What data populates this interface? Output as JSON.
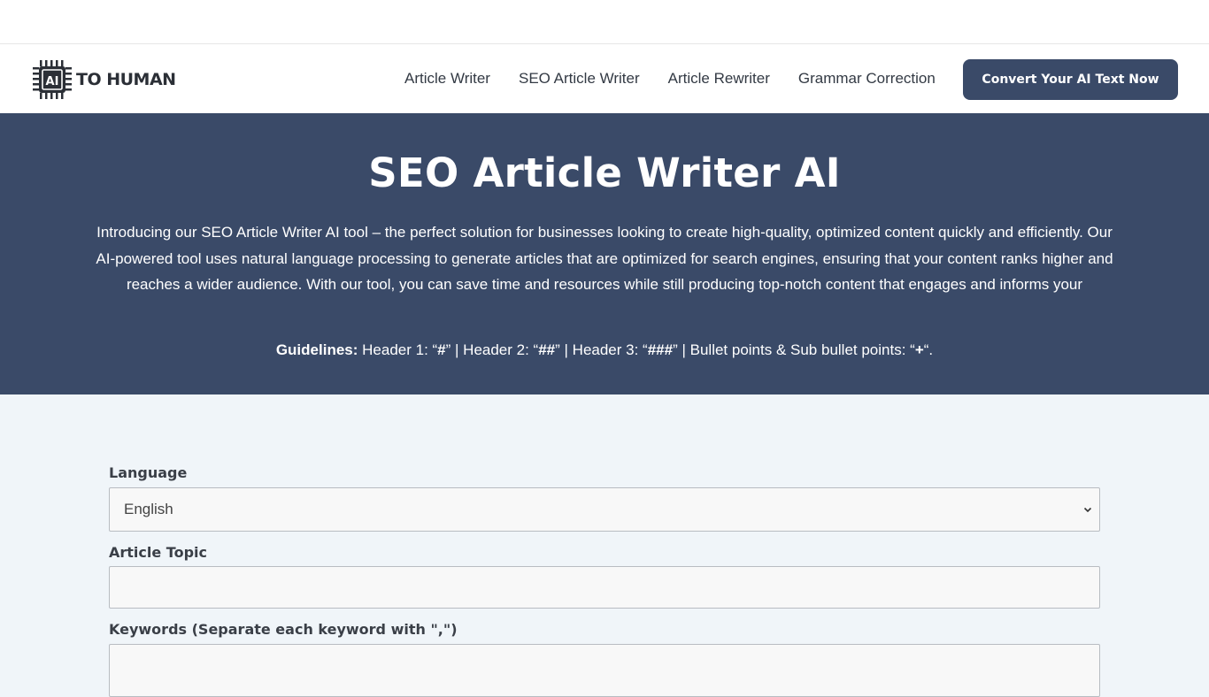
{
  "brand": {
    "logo_chip_text": "AI",
    "logo_text": "TO HUMAN"
  },
  "nav": {
    "items": [
      {
        "label": "Article Writer"
      },
      {
        "label": "SEO Article Writer"
      },
      {
        "label": "Article Rewriter"
      },
      {
        "label": "Grammar Correction"
      }
    ],
    "cta_label": "Convert Your AI Text Now"
  },
  "hero": {
    "title": "SEO Article Writer AI",
    "intro": "Introducing our SEO Article Writer AI tool – the perfect solution for businesses looking to create high-quality, optimized content quickly and efficiently. Our AI-powered tool uses natural language processing to generate articles that are optimized for search engines, ensuring that your content ranks higher and reaches a wider audience. With our tool, you can save time and resources while still producing top-notch content that engages and informs your",
    "guidelines_label": "Guidelines:",
    "guide_h1_prefix": " Header 1: “",
    "guide_h1_symbol": "#",
    "guide_h2_prefix": "” | Header 2: “",
    "guide_h2_symbol": "##",
    "guide_h3_prefix": "” | Header 3: “",
    "guide_h3_symbol": "###",
    "guide_bullet_prefix": "” | Bullet points & Sub bullet points: “",
    "guide_bullet_symbol": "+",
    "guide_end": "“."
  },
  "form": {
    "language_label": "Language",
    "language_value": "English",
    "topic_label": "Article Topic",
    "topic_value": "",
    "keywords_label": "Keywords (Separate each keyword with \",\")",
    "keywords_value": ""
  },
  "colors": {
    "primary": "#3a4a68",
    "page_bg": "#f0f5f9"
  }
}
